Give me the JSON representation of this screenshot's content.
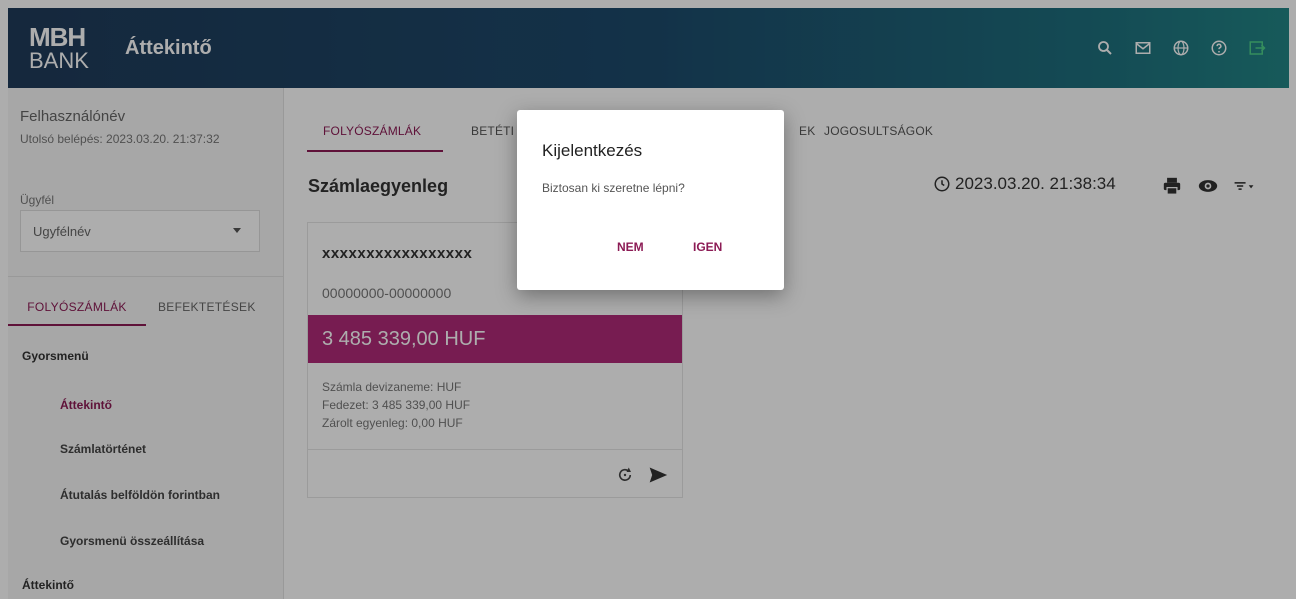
{
  "header": {
    "logo_line1": "MBH",
    "logo_line2": "BANK",
    "title": "Áttekintő",
    "icons": [
      "search-icon",
      "mail-icon",
      "globe-icon",
      "help-icon",
      "logout-icon"
    ]
  },
  "sidebar": {
    "username": "Felhasználónév",
    "last_login": "Utolsó belépés: 2023.03.20. 21:37:32",
    "client_label": "Ügyfél",
    "client_value": "Ugyfélnév",
    "tabs": [
      "FOLYÓSZÁMLÁK",
      "BEFEKTETÉSEK"
    ],
    "quickmenu_title": "Gyorsmenü",
    "menu_items": [
      "Áttekintő",
      "Számlatörténet",
      "Átutalás belföldön forintban",
      "Gyorsmenü összeállítása"
    ],
    "section2_title": "Áttekintő"
  },
  "main": {
    "tabs": [
      "FOLYÓSZÁMLÁK",
      "BETÉTI K",
      "EK",
      "JOGOSULTSÁGOK"
    ],
    "section_title": "Számlaegyenleg",
    "timestamp": "2023.03.20. 21:38:34",
    "toolbar_icons": [
      "print-icon",
      "eye-icon",
      "filter-icon"
    ],
    "card": {
      "account_name": "xxxxxxxxxxxxxxxxx",
      "account_number": "00000000-00000000",
      "balance": "3 485 339,00 HUF",
      "currency_line": "Számla devizaneme: HUF",
      "coverage_line": "Fedezet: 3 485 339,00 HUF",
      "blocked_line": "Zárolt egyenleg: 0,00 HUF"
    }
  },
  "dialog": {
    "title": "Kijelentkezés",
    "text": "Biztosan ki szeretne lépni?",
    "no_label": "NEM",
    "yes_label": "IGEN"
  },
  "colors": {
    "accent": "#8c1b55",
    "balance_bg": "#b02a78",
    "header_start": "#1f3b5a",
    "header_end": "#228585"
  }
}
